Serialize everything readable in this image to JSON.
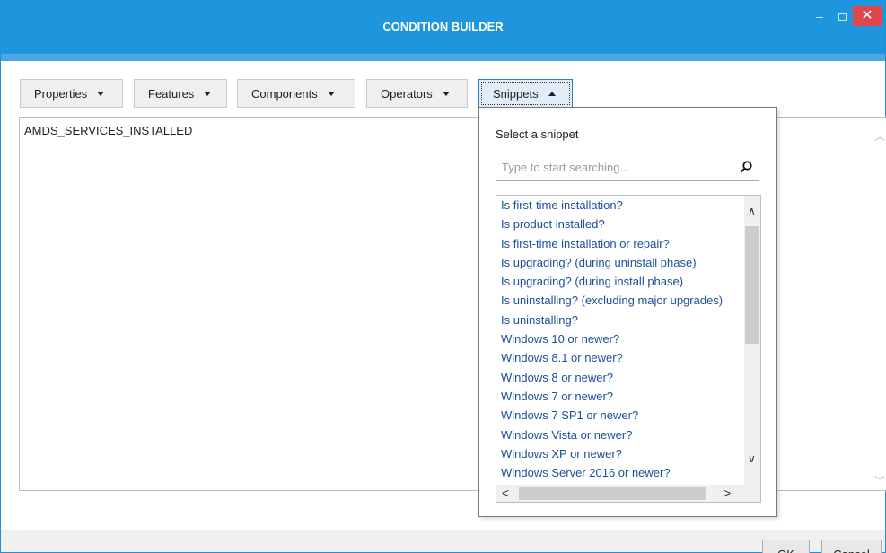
{
  "window": {
    "title": "CONDITION BUILDER",
    "min_glyph": "–",
    "close_glyph": "✕"
  },
  "toolbar": {
    "properties_label": "Properties",
    "features_label": "Features",
    "components_label": "Components",
    "operators_label": "Operators",
    "snippets_label": "Snippets"
  },
  "editor": {
    "value": "AMDS_SERVICES_INSTALLED",
    "scroll_up_glyph": "︿",
    "scroll_down_glyph": "﹀"
  },
  "snippets_popup": {
    "heading": "Select a snippet",
    "search_placeholder": "Type to start searching...",
    "items": [
      "Is first-time installation?",
      "Is product installed?",
      "Is first-time installation or repair?",
      "Is upgrading? (during uninstall phase)",
      "Is upgrading? (during install phase)",
      "Is uninstalling? (excluding major upgrades)",
      "Is uninstalling?",
      "Windows 10 or newer?",
      "Windows 8.1 or newer?",
      "Windows 8 or newer?",
      "Windows 7 or newer?",
      "Windows 7 SP1 or newer?",
      "Windows Vista or newer?",
      "Windows XP or newer?",
      "Windows Server 2016 or newer?"
    ],
    "scroll_up_glyph": "∧",
    "scroll_down_glyph": "∨",
    "scroll_left_glyph": "<",
    "scroll_right_glyph": ">"
  },
  "footer": {
    "ok_label": "OK",
    "cancel_label": "Cancel"
  },
  "colors": {
    "titlebar": "#1e95dc",
    "close_button": "#e0464b",
    "link_text": "#1b4f9c"
  }
}
